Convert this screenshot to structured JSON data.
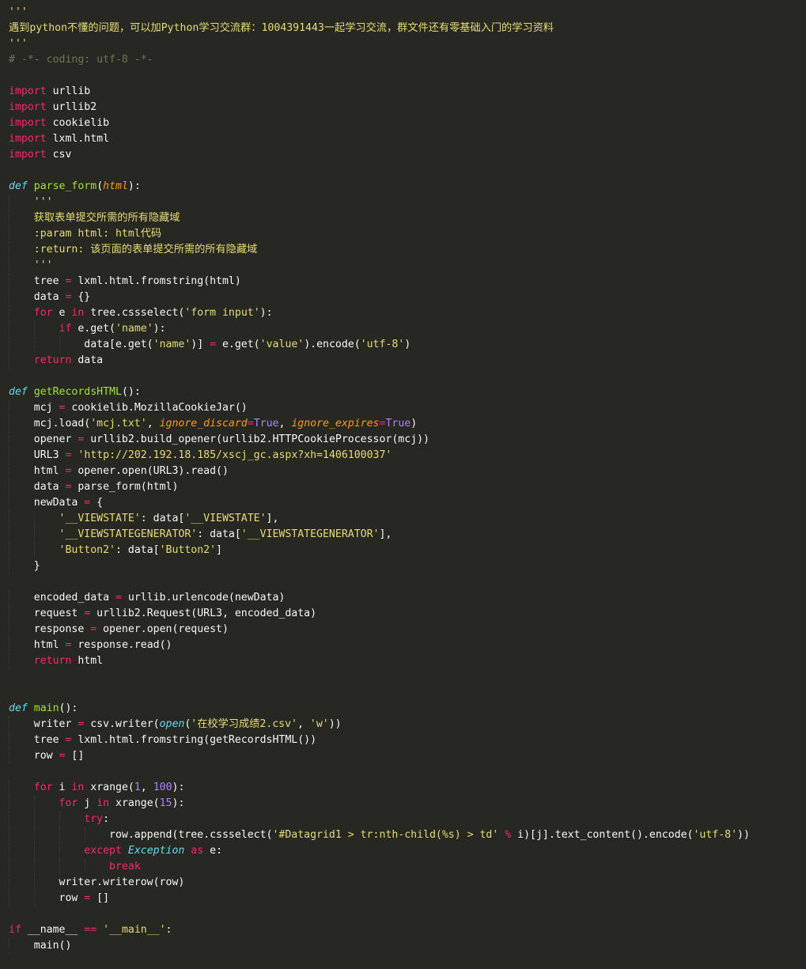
{
  "editor": {
    "language": "python",
    "theme": "monokai",
    "colors": {
      "background": "#272822",
      "keyword": "#f92672",
      "storage": "#66d9ef",
      "function": "#a6e22e",
      "string": "#e6db74",
      "number": "#ae81ff",
      "comment": "#75715e",
      "parameter": "#fd971f",
      "text": "#f8f8f2"
    },
    "lines": [
      {
        "tokens": [
          [
            "'''",
            "str"
          ]
        ]
      },
      {
        "tokens": [
          [
            "遇到python不懂的问题，可以加Python学习交流群：1004391443一起学习交流，群文件还有零基础入门的学习资料",
            "str"
          ]
        ]
      },
      {
        "tokens": [
          [
            "'''",
            "str"
          ]
        ]
      },
      {
        "tokens": [
          [
            "# -*- coding: utf-8 -*-",
            "cm"
          ]
        ]
      },
      {
        "tokens": []
      },
      {
        "tokens": [
          [
            "import",
            "kw"
          ],
          [
            " urllib",
            "pl"
          ]
        ]
      },
      {
        "tokens": [
          [
            "import",
            "kw"
          ],
          [
            " urllib2",
            "pl"
          ]
        ]
      },
      {
        "tokens": [
          [
            "import",
            "kw"
          ],
          [
            " cookielib",
            "pl"
          ]
        ]
      },
      {
        "tokens": [
          [
            "import",
            "kw"
          ],
          [
            " lxml.html",
            "pl"
          ]
        ]
      },
      {
        "tokens": [
          [
            "import",
            "kw"
          ],
          [
            " csv",
            "pl"
          ]
        ]
      },
      {
        "tokens": []
      },
      {
        "tokens": [
          [
            "def",
            "def"
          ],
          [
            " ",
            "pl"
          ],
          [
            "parse_form",
            "fn"
          ],
          [
            "(",
            "pl"
          ],
          [
            "html",
            "arg"
          ],
          [
            "):",
            "pl"
          ]
        ]
      },
      {
        "tokens": [
          [
            "    '''",
            "str"
          ]
        ]
      },
      {
        "tokens": [
          [
            "    获取表单提交所需的所有隐藏域",
            "str"
          ]
        ]
      },
      {
        "tokens": [
          [
            "    :param html: html代码",
            "str"
          ]
        ]
      },
      {
        "tokens": [
          [
            "    :return: 该页面的表单提交所需的所有隐藏域",
            "str"
          ]
        ]
      },
      {
        "tokens": [
          [
            "    '''",
            "str"
          ]
        ]
      },
      {
        "tokens": [
          [
            "    tree ",
            "pl"
          ],
          [
            "=",
            "kw"
          ],
          [
            " lxml.html.fromstring(html)",
            "pl"
          ]
        ]
      },
      {
        "tokens": [
          [
            "    data ",
            "pl"
          ],
          [
            "=",
            "kw"
          ],
          [
            " {}",
            "pl"
          ]
        ]
      },
      {
        "tokens": [
          [
            "    ",
            "pl"
          ],
          [
            "for",
            "kw"
          ],
          [
            " e ",
            "pl"
          ],
          [
            "in",
            "kw"
          ],
          [
            " tree.cssselect(",
            "pl"
          ],
          [
            "'form input'",
            "str"
          ],
          [
            "):",
            "pl"
          ]
        ]
      },
      {
        "tokens": [
          [
            "        ",
            "pl"
          ],
          [
            "if",
            "kw"
          ],
          [
            " e.get(",
            "pl"
          ],
          [
            "'name'",
            "str"
          ],
          [
            "):",
            "pl"
          ]
        ]
      },
      {
        "tokens": [
          [
            "            data[e.get(",
            "pl"
          ],
          [
            "'name'",
            "str"
          ],
          [
            ")] ",
            "pl"
          ],
          [
            "=",
            "kw"
          ],
          [
            " e.get(",
            "pl"
          ],
          [
            "'value'",
            "str"
          ],
          [
            ").encode(",
            "pl"
          ],
          [
            "'utf-8'",
            "str"
          ],
          [
            ")",
            "pl"
          ]
        ]
      },
      {
        "tokens": [
          [
            "    ",
            "pl"
          ],
          [
            "return",
            "kw"
          ],
          [
            " data",
            "pl"
          ]
        ]
      },
      {
        "tokens": []
      },
      {
        "tokens": [
          [
            "def",
            "def"
          ],
          [
            " ",
            "pl"
          ],
          [
            "getRecordsHTML",
            "fn"
          ],
          [
            "():",
            "pl"
          ]
        ]
      },
      {
        "tokens": [
          [
            "    mcj ",
            "pl"
          ],
          [
            "=",
            "kw"
          ],
          [
            " cookielib.MozillaCookieJar()",
            "pl"
          ]
        ]
      },
      {
        "tokens": [
          [
            "    mcj.load(",
            "pl"
          ],
          [
            "'mcj.txt'",
            "str"
          ],
          [
            ", ",
            "pl"
          ],
          [
            "ignore_discard",
            "arg"
          ],
          [
            "=",
            "kw"
          ],
          [
            "True",
            "num"
          ],
          [
            ", ",
            "pl"
          ],
          [
            "ignore_expires",
            "arg"
          ],
          [
            "=",
            "kw"
          ],
          [
            "True",
            "num"
          ],
          [
            ")",
            "pl"
          ]
        ]
      },
      {
        "tokens": [
          [
            "    opener ",
            "pl"
          ],
          [
            "=",
            "kw"
          ],
          [
            " urllib2.build_opener(urllib2.HTTPCookieProcessor(mcj))",
            "pl"
          ]
        ]
      },
      {
        "tokens": [
          [
            "    URL3 ",
            "pl"
          ],
          [
            "=",
            "kw"
          ],
          [
            " ",
            "pl"
          ],
          [
            "'http://202.192.18.185/xscj_gc.aspx?xh=1406100037'",
            "str"
          ]
        ]
      },
      {
        "tokens": [
          [
            "    html ",
            "pl"
          ],
          [
            "=",
            "kw"
          ],
          [
            " opener.open(URL3).read()",
            "pl"
          ]
        ]
      },
      {
        "tokens": [
          [
            "    data ",
            "pl"
          ],
          [
            "=",
            "kw"
          ],
          [
            " parse_form(html)",
            "pl"
          ]
        ]
      },
      {
        "tokens": [
          [
            "    newData ",
            "pl"
          ],
          [
            "=",
            "kw"
          ],
          [
            " {",
            "pl"
          ]
        ]
      },
      {
        "tokens": [
          [
            "        ",
            "pl"
          ],
          [
            "'__VIEWSTATE'",
            "str"
          ],
          [
            ": data[",
            "pl"
          ],
          [
            "'__VIEWSTATE'",
            "str"
          ],
          [
            "],",
            "pl"
          ]
        ]
      },
      {
        "tokens": [
          [
            "        ",
            "pl"
          ],
          [
            "'__VIEWSTATEGENERATOR'",
            "str"
          ],
          [
            ": data[",
            "pl"
          ],
          [
            "'__VIEWSTATEGENERATOR'",
            "str"
          ],
          [
            "],",
            "pl"
          ]
        ]
      },
      {
        "tokens": [
          [
            "        ",
            "pl"
          ],
          [
            "'Button2'",
            "str"
          ],
          [
            ": data[",
            "pl"
          ],
          [
            "'Button2'",
            "str"
          ],
          [
            "]",
            "pl"
          ]
        ]
      },
      {
        "tokens": [
          [
            "    }",
            "pl"
          ]
        ]
      },
      {
        "tokens": []
      },
      {
        "tokens": [
          [
            "    encoded_data ",
            "pl"
          ],
          [
            "=",
            "kw"
          ],
          [
            " urllib.urlencode(newData)",
            "pl"
          ]
        ]
      },
      {
        "tokens": [
          [
            "    request ",
            "pl"
          ],
          [
            "=",
            "kw"
          ],
          [
            " urllib2.Request(URL3, encoded_data)",
            "pl"
          ]
        ]
      },
      {
        "tokens": [
          [
            "    response ",
            "pl"
          ],
          [
            "=",
            "kw"
          ],
          [
            " opener.open(request)",
            "pl"
          ]
        ]
      },
      {
        "tokens": [
          [
            "    html ",
            "pl"
          ],
          [
            "=",
            "kw"
          ],
          [
            " response.read()",
            "pl"
          ]
        ]
      },
      {
        "tokens": [
          [
            "    ",
            "pl"
          ],
          [
            "return",
            "kw"
          ],
          [
            " html",
            "pl"
          ]
        ]
      },
      {
        "tokens": []
      },
      {
        "tokens": []
      },
      {
        "tokens": [
          [
            "def",
            "def"
          ],
          [
            " ",
            "pl"
          ],
          [
            "main",
            "fn"
          ],
          [
            "():",
            "pl"
          ]
        ]
      },
      {
        "tokens": [
          [
            "    writer ",
            "pl"
          ],
          [
            "=",
            "kw"
          ],
          [
            " csv.writer(",
            "pl"
          ],
          [
            "open",
            "bi"
          ],
          [
            "(",
            "pl"
          ],
          [
            "'在校学习成绩2.csv'",
            "str"
          ],
          [
            ", ",
            "pl"
          ],
          [
            "'w'",
            "str"
          ],
          [
            "))",
            "pl"
          ]
        ]
      },
      {
        "tokens": [
          [
            "    tree ",
            "pl"
          ],
          [
            "=",
            "kw"
          ],
          [
            " lxml.html.fromstring(getRecordsHTML())",
            "pl"
          ]
        ]
      },
      {
        "tokens": [
          [
            "    row ",
            "pl"
          ],
          [
            "=",
            "kw"
          ],
          [
            " []",
            "pl"
          ]
        ]
      },
      {
        "tokens": []
      },
      {
        "tokens": [
          [
            "    ",
            "pl"
          ],
          [
            "for",
            "kw"
          ],
          [
            " i ",
            "pl"
          ],
          [
            "in",
            "kw"
          ],
          [
            " xrange(",
            "pl"
          ],
          [
            "1",
            "num"
          ],
          [
            ", ",
            "pl"
          ],
          [
            "100",
            "num"
          ],
          [
            "):",
            "pl"
          ]
        ]
      },
      {
        "tokens": [
          [
            "        ",
            "pl"
          ],
          [
            "for",
            "kw"
          ],
          [
            " j ",
            "pl"
          ],
          [
            "in",
            "kw"
          ],
          [
            " xrange(",
            "pl"
          ],
          [
            "15",
            "num"
          ],
          [
            "):",
            "pl"
          ]
        ]
      },
      {
        "tokens": [
          [
            "            ",
            "pl"
          ],
          [
            "try",
            "kw"
          ],
          [
            ":",
            "pl"
          ]
        ]
      },
      {
        "tokens": [
          [
            "                row.append(tree.cssselect(",
            "pl"
          ],
          [
            "'#Datagrid1 > tr:nth-child(%s) > td'",
            "str"
          ],
          [
            " ",
            "pl"
          ],
          [
            "%",
            "kw"
          ],
          [
            " i)[j].text_content().encode(",
            "pl"
          ],
          [
            "'utf-8'",
            "str"
          ],
          [
            "))",
            "pl"
          ]
        ]
      },
      {
        "tokens": [
          [
            "            ",
            "pl"
          ],
          [
            "except",
            "kw"
          ],
          [
            " ",
            "pl"
          ],
          [
            "Exception",
            "bi"
          ],
          [
            " ",
            "pl"
          ],
          [
            "as",
            "kw"
          ],
          [
            " e:",
            "pl"
          ]
        ]
      },
      {
        "tokens": [
          [
            "                ",
            "pl"
          ],
          [
            "break",
            "kw"
          ]
        ]
      },
      {
        "tokens": [
          [
            "        writer.writerow(row)",
            "pl"
          ]
        ]
      },
      {
        "tokens": [
          [
            "        row ",
            "pl"
          ],
          [
            "=",
            "kw"
          ],
          [
            " []",
            "pl"
          ]
        ]
      },
      {
        "tokens": []
      },
      {
        "tokens": [
          [
            "if",
            "kw"
          ],
          [
            " __name__ ",
            "pl"
          ],
          [
            "==",
            "kw"
          ],
          [
            " ",
            "pl"
          ],
          [
            "'__main__'",
            "str"
          ],
          [
            ":",
            "pl"
          ]
        ]
      },
      {
        "tokens": [
          [
            "    main()",
            "pl"
          ]
        ]
      }
    ]
  }
}
